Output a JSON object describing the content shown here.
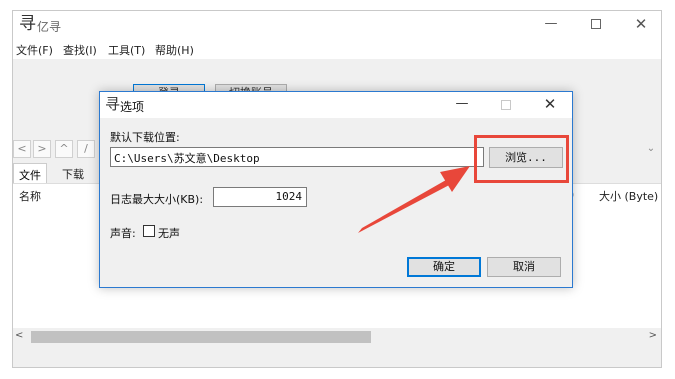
{
  "app": {
    "title": "亿寻",
    "logo_glyph": "寻"
  },
  "window_controls": {
    "minimize": "—",
    "close": "✕"
  },
  "menu": {
    "file": "文件(F)",
    "find": "查找(I)",
    "tools": "工具(T)",
    "help": "帮助(H)"
  },
  "toolbar": {
    "login": "登录",
    "switch_account": "切换账号"
  },
  "nav": {
    "back": "<",
    "forward": ">",
    "up": "^",
    "root": "/",
    "dropdown": "⌄"
  },
  "tabs": {
    "files": "文件",
    "downloads": "下载"
  },
  "file_list": {
    "col_name": "名称",
    "col_sep": ")",
    "col_size": "大小 (Byte)"
  },
  "scrollbar": {
    "left": "<",
    "right": ">"
  },
  "dialog": {
    "title": "选项",
    "logo_glyph": "寻",
    "minimize": "—",
    "close": "✕",
    "download_label": "默认下载位置:",
    "download_path": "C:\\Users\\苏文意\\Desktop",
    "browse": "浏览...",
    "log_size_label": "日志最大大小(KB):",
    "log_size_value": "1024",
    "sound_label": "声音:",
    "mute_label": "无声",
    "mute_checked": false,
    "ok": "确定",
    "cancel": "取消"
  },
  "colors": {
    "annotation": "#e8473a",
    "dialog_border": "#2b79d0",
    "focus": "#0078d7"
  }
}
